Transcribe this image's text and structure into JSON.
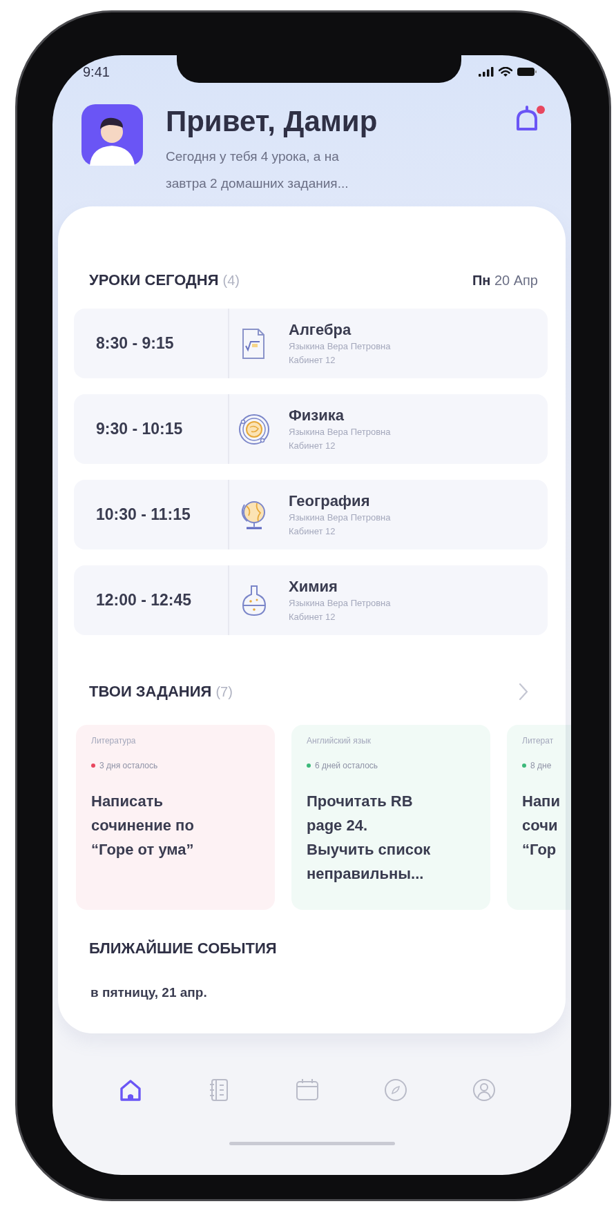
{
  "status_bar": {
    "time": "9:41"
  },
  "header": {
    "title": "Привет, Дамир",
    "subtitle": "Сегодня у тебя 4 урока,  а на завтра 2 домашних задания...",
    "has_notification": true
  },
  "lessons_section": {
    "title": "УРОКИ СЕГОДНЯ",
    "count": "(4)",
    "date": "**Пн** 20 Апр"
  },
  "lessons": [
    {
      "time": "8:30 - 9:15",
      "kind": "document",
      "subject": "Алгебра",
      "teacher": "Языкина Вера Петровна",
      "room": "Кабинет 12"
    },
    {
      "time": "9:30 - 10:15",
      "kind": "atom",
      "subject": "Физика",
      "teacher": "Языкина Вера Петровна",
      "room": "Кабинет 12"
    },
    {
      "time": "10:30 - 11:15",
      "kind": "globe",
      "subject": "География",
      "teacher": "Языкина Вера Петровна",
      "room": "Кабинет 12"
    },
    {
      "time": "12:00 - 12:45",
      "kind": "flask",
      "subject": "Химия",
      "teacher": "Языкина Вера Петровна",
      "room": "Кабинет 12"
    }
  ],
  "tasks_section": {
    "title": "ТВОИ ЗАДАНИЯ",
    "count": "(7)"
  },
  "tasks": [
    {
      "subject": "Литература",
      "deadline": "3 дня осталось",
      "color": "#e8475f",
      "title_lines": [
        "Написать",
        "сочинение по",
        "“Горе от ума”"
      ]
    },
    {
      "subject": "Английский язык",
      "deadline": "6 дней осталось",
      "color": "#3cb97a",
      "title_lines": [
        "Прочитать RB",
        "page 24.",
        "Выучить список",
        "неправильны..."
      ]
    },
    {
      "subject": "Литерат",
      "deadline": "8 дне",
      "color": "#3cb97a",
      "title_lines": [
        "Напи",
        "сочи",
        "“Гор"
      ]
    }
  ],
  "events_section": {
    "title": "БЛИЖАЙШИЕ СОБЫТИЯ",
    "date": "в пятницу, 21 апр."
  },
  "tab_bar": [
    {
      "kind": "home",
      "selected": true
    },
    {
      "kind": "notebook",
      "selected": false
    },
    {
      "kind": "calendar",
      "selected": false
    },
    {
      "kind": "compass",
      "selected": false
    },
    {
      "kind": "profile",
      "selected": false
    }
  ]
}
